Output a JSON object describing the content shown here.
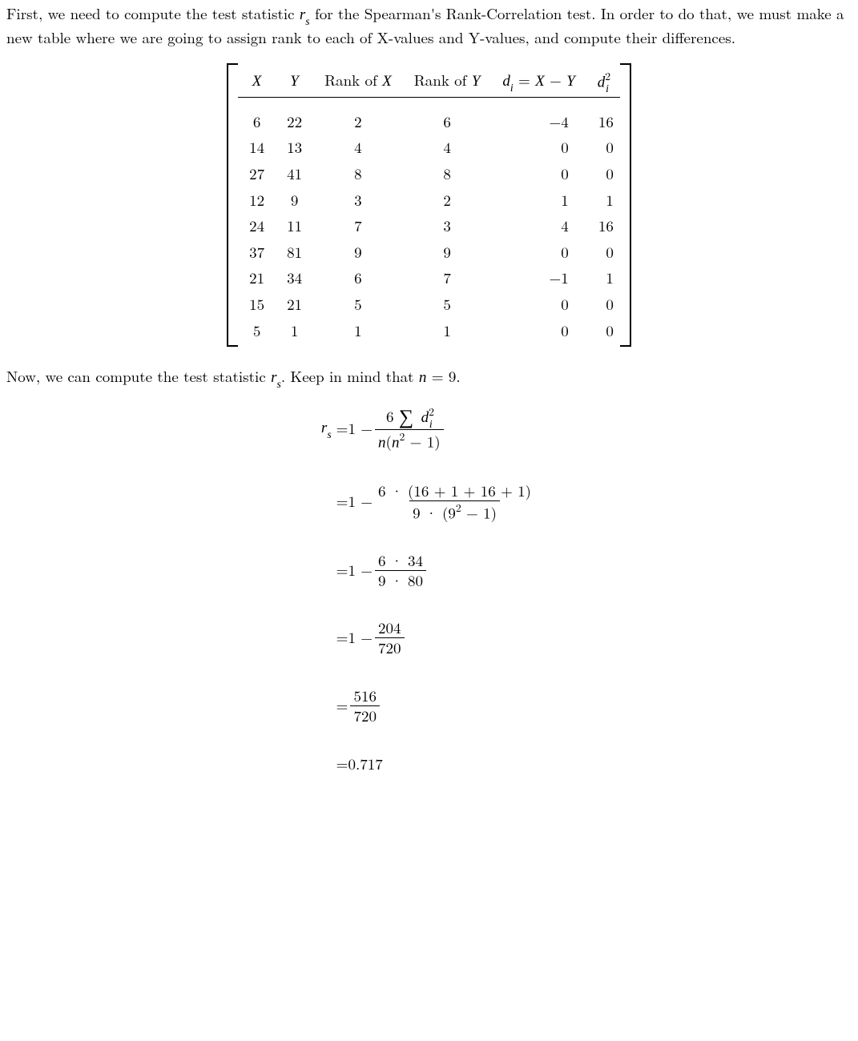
{
  "intro": {
    "p1a": "First, we need to compute the test statistic ",
    "rs_r": "r",
    "rs_s": "s",
    "p1b": " for the Spearman's Rank-Correlation test. In order to do that, we must make a new table where we are going to assign rank to each of X-values and Y-values, and compute their differences."
  },
  "table": {
    "head": {
      "X": "X",
      "Y": "Y",
      "rankX_a": "Rank of ",
      "rankX_b": "X",
      "rankY_a": "Rank of ",
      "rankY_b": "Y",
      "di_a": "d",
      "di_b": "i",
      "di_eq": " = ",
      "di_X": "X",
      "di_minus": " − ",
      "di_Y": "Y",
      "d2_a": "d",
      "d2_b": "2",
      "d2_c": "i"
    },
    "rows": [
      {
        "x": "6",
        "y": "22",
        "rx": "2",
        "ry": "6",
        "d": "−4",
        "d2": "16"
      },
      {
        "x": "14",
        "y": "13",
        "rx": "4",
        "ry": "4",
        "d": "0",
        "d2": "0"
      },
      {
        "x": "27",
        "y": "41",
        "rx": "8",
        "ry": "8",
        "d": "0",
        "d2": "0"
      },
      {
        "x": "12",
        "y": "9",
        "rx": "3",
        "ry": "2",
        "d": "1",
        "d2": "1"
      },
      {
        "x": "24",
        "y": "11",
        "rx": "7",
        "ry": "3",
        "d": "4",
        "d2": "16"
      },
      {
        "x": "37",
        "y": "81",
        "rx": "9",
        "ry": "9",
        "d": "0",
        "d2": "0"
      },
      {
        "x": "21",
        "y": "34",
        "rx": "6",
        "ry": "7",
        "d": "−1",
        "d2": "1"
      },
      {
        "x": "15",
        "y": "21",
        "rx": "5",
        "ry": "5",
        "d": "0",
        "d2": "0"
      },
      {
        "x": "5",
        "y": "1",
        "rx": "1",
        "ry": "1",
        "d": "0",
        "d2": "0"
      }
    ]
  },
  "mid": {
    "a": "Now, we can compute the test statistic ",
    "rs_r": "r",
    "rs_s": "s",
    "b": ". Keep in mind that ",
    "n": "n",
    "eq": " = 9."
  },
  "eq": {
    "lhs_r": "r",
    "lhs_s": "s",
    "eqsym": " = ",
    "one_minus": "1 − ",
    "l1_num_a": "6 ",
    "l1_num_sum": "∑",
    "l1_num_d": "d",
    "l1_num_sup": "2",
    "l1_num_sub": "i",
    "l1_den_a": "n",
    "l1_den_b": "(",
    "l1_den_c": "n",
    "l1_den_d": "2",
    "l1_den_e": " − 1)",
    "l2_num": "6 · (16 + 1 + 16 + 1)",
    "l2_den_a": "9 · (9",
    "l2_den_b": "2",
    "l2_den_c": " − 1)",
    "l3_num": "6 · 34",
    "l3_den": "9 · 80",
    "l4_num": "204",
    "l4_den": "720",
    "l5_num": "516",
    "l5_den": "720",
    "l6": "0.717"
  }
}
